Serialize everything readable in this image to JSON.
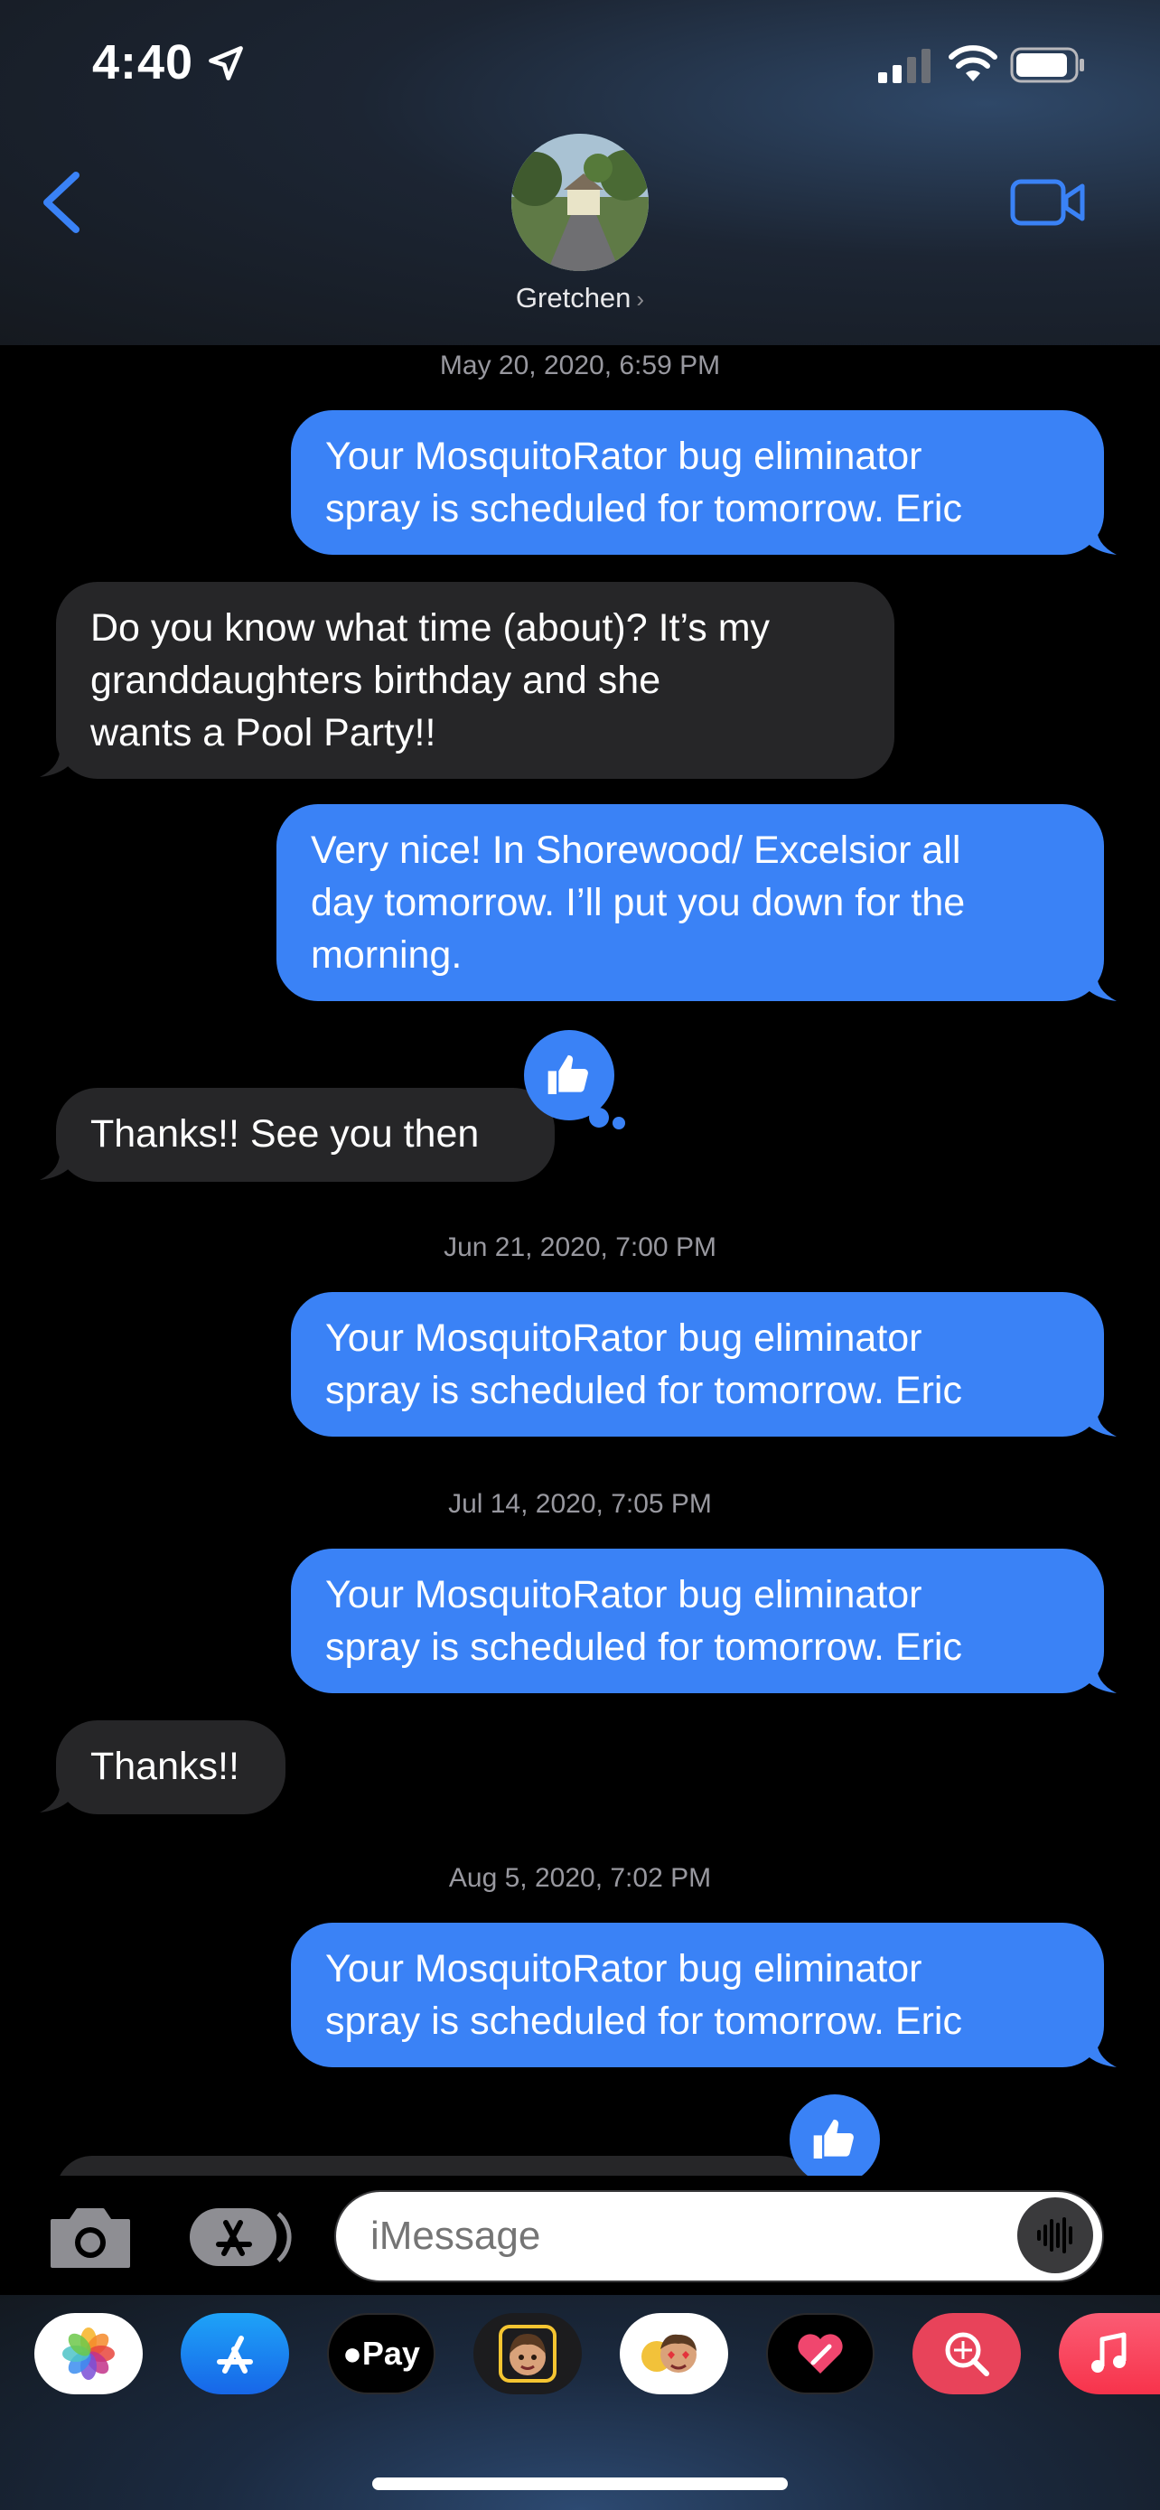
{
  "status": {
    "time": "4:40"
  },
  "header": {
    "contact_name": "Gretchen"
  },
  "messages": [
    {
      "type": "timestamp",
      "text": "May 20, 2020, 6:59 PM"
    },
    {
      "type": "outgoing",
      "text": "Your MosquitoRator bug eliminator\nspray is scheduled for tomorrow.   Eric"
    },
    {
      "type": "incoming",
      "text": "Do you know what time (about)? It’s my\ngranddaughters birthday and she\nwants a Pool Party!!"
    },
    {
      "type": "outgoing",
      "text": "Very nice!  In Shorewood/ Excelsior all\nday tomorrow. I’ll put you down for the\nmorning."
    },
    {
      "type": "incoming",
      "text": "Thanks!! See you then",
      "reaction": "thumbs-up"
    },
    {
      "type": "timestamp",
      "text": "Jun 21, 2020, 7:00 PM"
    },
    {
      "type": "outgoing",
      "text": "Your MosquitoRator bug eliminator\nspray is scheduled for tomorrow.   Eric"
    },
    {
      "type": "timestamp",
      "text": "Jul 14, 2020, 7:05 PM"
    },
    {
      "type": "outgoing",
      "text": "Your MosquitoRator bug eliminator\nspray is scheduled for tomorrow.   Eric"
    },
    {
      "type": "incoming",
      "text": "Thanks!!"
    },
    {
      "type": "timestamp",
      "text": "Aug 5, 2020, 7:02 PM"
    },
    {
      "type": "outgoing",
      "text": "Your MosquitoRator bug eliminator\nspray is scheduled for tomorrow.   Eric",
      "reaction": "thumbs-up"
    }
  ],
  "input": {
    "placeholder": "iMessage"
  },
  "app_drawer": [
    {
      "icon": "photos-icon"
    },
    {
      "icon": "app-store-icon"
    },
    {
      "icon": "apple-pay-icon",
      "label": "Pay"
    },
    {
      "icon": "memoji-icon"
    },
    {
      "icon": "memoji-stickers-icon"
    },
    {
      "icon": "digital-touch-icon"
    },
    {
      "icon": "images-search-icon"
    },
    {
      "icon": "music-icon"
    }
  ],
  "colors": {
    "outgoing_bubble": "#3a82f6",
    "incoming_bubble": "#262628",
    "accent": "#3a82f6"
  }
}
